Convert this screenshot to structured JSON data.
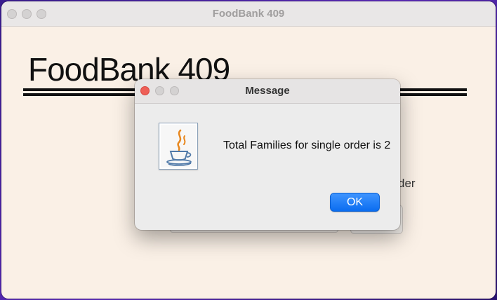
{
  "window": {
    "title": "FoodBank 409"
  },
  "app": {
    "heading": "FoodBank 409",
    "partial_label": "der"
  },
  "dialog": {
    "title": "Message",
    "message": "Total Families for single order is 2",
    "ok_label": "OK",
    "icon": "java-coffee-icon"
  }
}
